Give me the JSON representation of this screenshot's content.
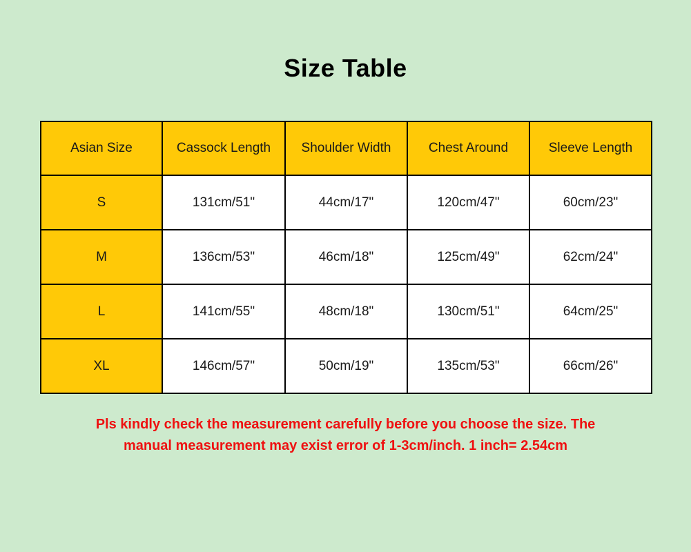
{
  "title": "Size Table",
  "colors": {
    "background": "#cdeacd",
    "header_fill": "#ffc907",
    "size_column_fill": "#ffc907",
    "cell_fill": "#ffffff",
    "border": "#000000",
    "note_text": "#ee1111",
    "title_text": "#000000"
  },
  "table": {
    "columns": [
      "Asian Size",
      "Cassock Length",
      "Shoulder Width",
      "Chest Around",
      "Sleeve Length"
    ],
    "rows": [
      {
        "size": "S",
        "cassock_length": "131cm/51\"",
        "shoulder_width": "44cm/17\"",
        "chest_around": "120cm/47\"",
        "sleeve_length": "60cm/23\""
      },
      {
        "size": "M",
        "cassock_length": "136cm/53\"",
        "shoulder_width": "46cm/18\"",
        "chest_around": "125cm/49\"",
        "sleeve_length": "62cm/24\""
      },
      {
        "size": "L",
        "cassock_length": "141cm/55\"",
        "shoulder_width": "48cm/18\"",
        "chest_around": "130cm/51\"",
        "sleeve_length": "64cm/25\""
      },
      {
        "size": "XL",
        "cassock_length": "146cm/57\"",
        "shoulder_width": "50cm/19\"",
        "chest_around": "135cm/53\"",
        "sleeve_length": "66cm/26\""
      }
    ]
  },
  "note": {
    "line1": "Pls kindly check the measurement carefully before you choose the size.  The",
    "line2": "manual measurement may exist error of 1-3cm/inch.  1 inch= 2.54cm"
  }
}
